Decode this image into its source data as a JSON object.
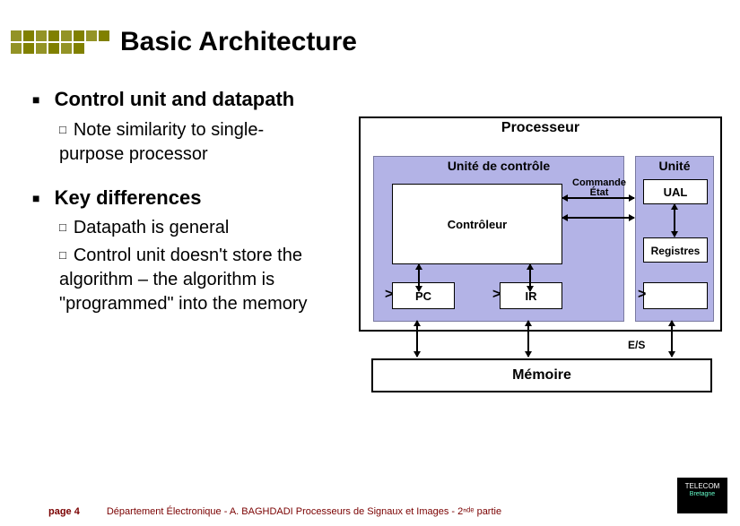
{
  "slide": {
    "title": "Basic Architecture",
    "bullets": [
      {
        "text": "Control unit and datapath",
        "sub": [
          "Note similarity to single-purpose processor"
        ]
      },
      {
        "text": "Key differences",
        "sub": [
          "Datapath is general",
          "Control unit doesn't store the algorithm – the algorithm is \"programmed\" into the memory"
        ]
      }
    ]
  },
  "diagram": {
    "processor": "Processeur",
    "control_unit": "Unité de contrôle",
    "datapath_unit": "Unité",
    "controller": "Contrôleur",
    "command_state": "Commande État",
    "pc": "PC",
    "ir": "IR",
    "alu": "UAL",
    "registers": "Registres",
    "memory": "Mémoire",
    "io": "E/S"
  },
  "footer": {
    "page": "page 4",
    "text": "Département Électronique - A. BAGHDADI  Processeurs de Signaux et Images - 2ⁿᵈᵉ partie",
    "logo_top": "TELECOM",
    "logo_bottom": "Bretagne"
  }
}
